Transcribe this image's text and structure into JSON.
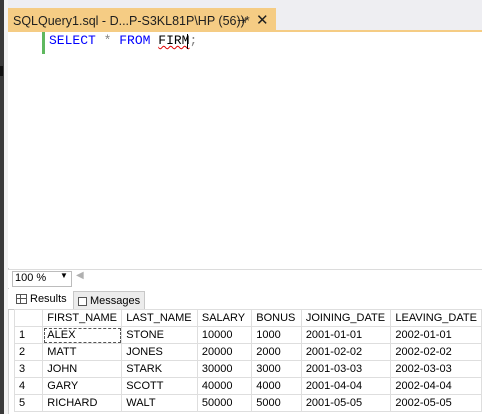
{
  "tab": {
    "title": "SQLQuery1.sql - D...P-S3KL81P\\HP (56))*",
    "pin_glyph": "⇥",
    "close_glyph": "✕"
  },
  "editor": {
    "kw_select": "SELECT",
    "star": "*",
    "kw_from": "FROM",
    "table": "FIRM",
    "semicolon": ";"
  },
  "zoom": {
    "value": "100 %"
  },
  "results_tabs": {
    "results": "Results",
    "messages": "Messages"
  },
  "grid": {
    "columns": [
      "",
      "FIRST_NAME",
      "LAST_NAME",
      "SALARY",
      "BONUS",
      "JOINING_DATE",
      "LEAVING_DATE"
    ],
    "rows": [
      [
        "1",
        "ALEX",
        "STONE",
        "10000",
        "1000",
        "2001-01-01",
        "2002-01-01"
      ],
      [
        "2",
        "MATT",
        "JONES",
        "20000",
        "2000",
        "2001-02-02",
        "2002-02-02"
      ],
      [
        "3",
        "JOHN",
        "STARK",
        "30000",
        "3000",
        "2001-03-03",
        "2002-03-03"
      ],
      [
        "4",
        "GARY",
        "SCOTT",
        "40000",
        "4000",
        "2001-04-04",
        "2002-04-04"
      ],
      [
        "5",
        "RICHARD",
        "WALT",
        "50000",
        "5000",
        "2001-05-05",
        "2002-05-05"
      ]
    ]
  },
  "colors": {
    "tab_accent": "#f5cc84",
    "keyword": "#0000ff",
    "squiggle": "#e00000"
  }
}
